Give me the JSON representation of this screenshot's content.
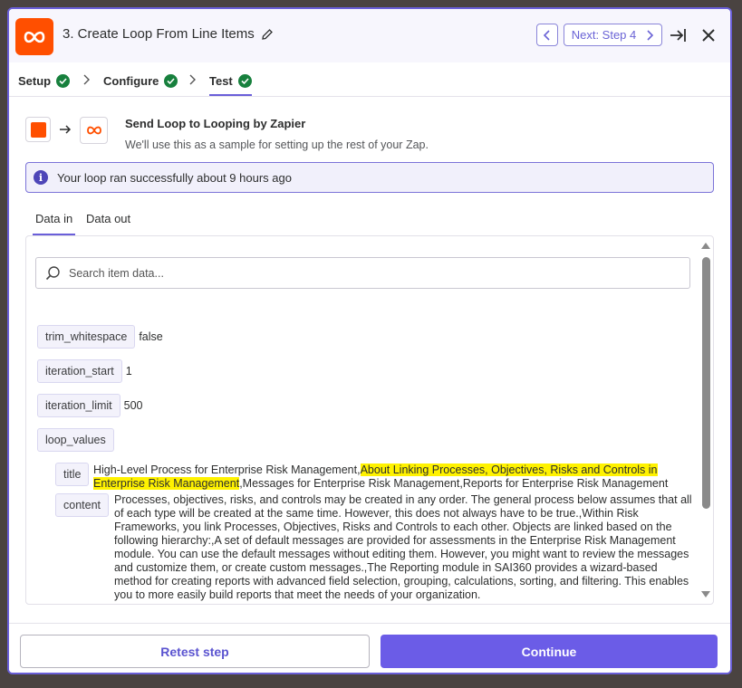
{
  "header": {
    "title": "3. Create Loop From Line Items",
    "next_label": "Next: Step 4"
  },
  "tabs": [
    {
      "label": "Setup",
      "complete": true
    },
    {
      "label": "Configure",
      "complete": true
    },
    {
      "label": "Test",
      "complete": true,
      "active": true
    }
  ],
  "send": {
    "title": "Send Loop to Looping by Zapier",
    "subtitle": "We'll use this as a sample for setting up the rest of your Zap."
  },
  "banner": {
    "text": "Your loop ran successfully about 9 hours ago"
  },
  "data_tabs": [
    {
      "label": "Data in",
      "active": true
    },
    {
      "label": "Data out",
      "active": false
    }
  ],
  "search": {
    "placeholder": "Search item data..."
  },
  "fields": [
    {
      "key": "trim_whitespace",
      "value": "false"
    },
    {
      "key": "iteration_start",
      "value": "1"
    },
    {
      "key": "iteration_limit",
      "value": "500"
    },
    {
      "key": "loop_values",
      "value": ""
    }
  ],
  "loop_values": {
    "title_key": "title",
    "title_part1": "High-Level Process for Enterprise Risk Management,",
    "title_highlight": "About Linking Processes, Objectives, Risks and Controls in Enterprise Risk Management",
    "title_part2": ",Messages for Enterprise Risk Management,Reports for Enterprise Risk Management",
    "content_key": "content",
    "content_text": "Processes, objectives, risks, and controls may be created in any order. The general process below assumes that all of each type will be created at the same time. However, this does not always have to be true.,Within Risk Frameworks, you link Processes, Objectives, Risks and Controls to each other. Objects are linked based on the following hierarchy:,A set of default messages are provided for assessments in the Enterprise Risk Management module. You can use the default messages without editing them. However, you might want to review the messages and customize them, or create custom messages.,The Reporting module in SAI360 provides a wizard-based method for creating reports with advanced field selection, grouping, calculations, sorting, and filtering. This enables you to more easily build reports that meet the needs of your organization."
  },
  "footer": {
    "retest_label": "Retest step",
    "continue_label": "Continue"
  },
  "colors": {
    "accent": "#6b5ce7",
    "brand_orange": "#ff4f00",
    "success": "#17803d",
    "highlight": "#fff200"
  }
}
